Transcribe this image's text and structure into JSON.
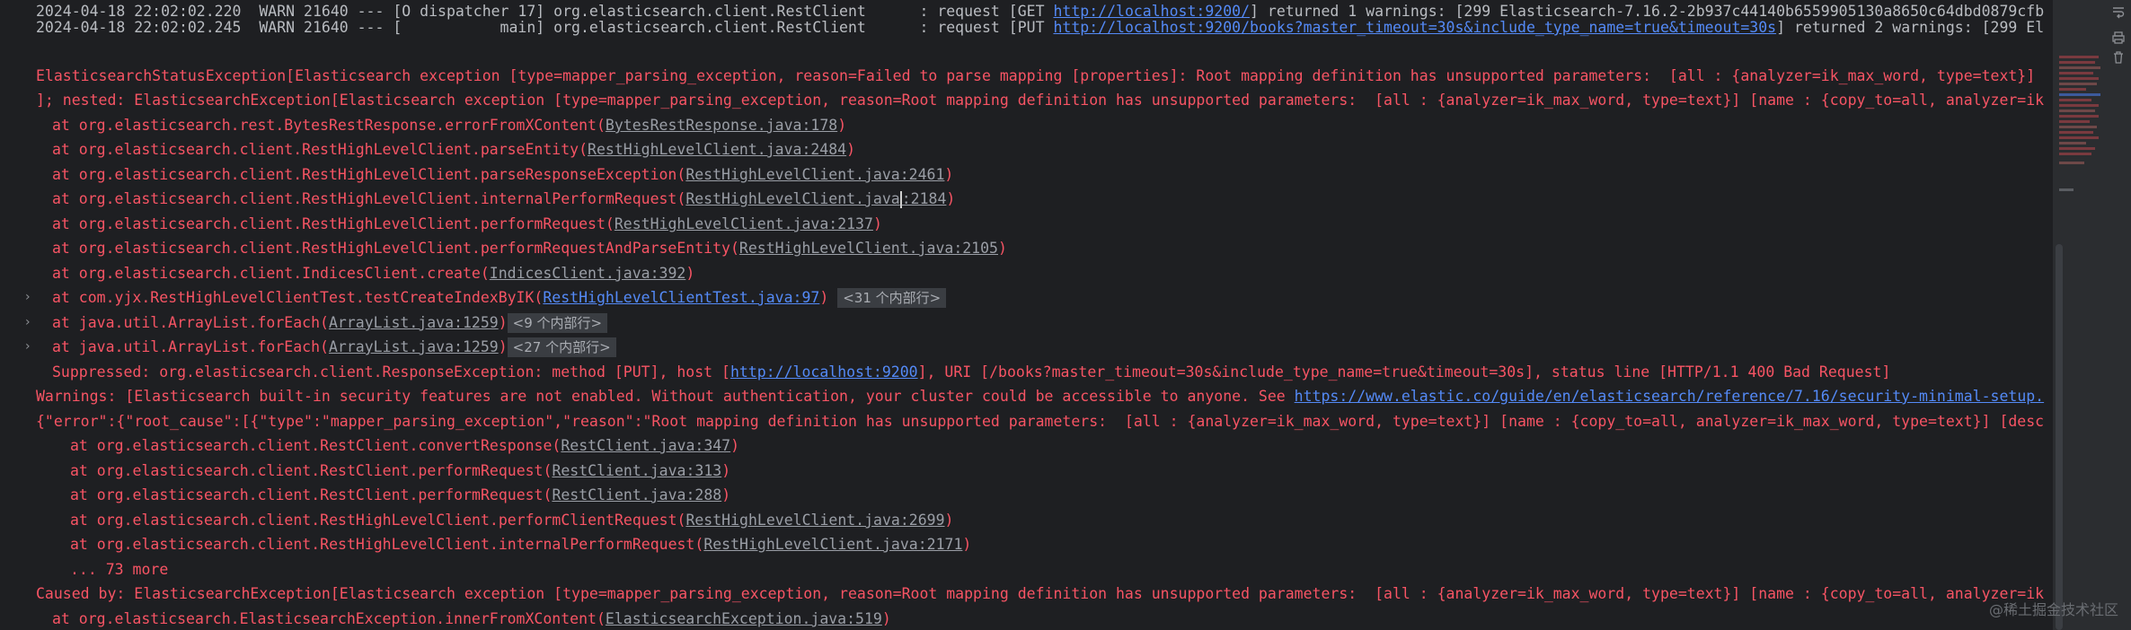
{
  "log": {
    "line1": {
      "prefix": "2024-04-18 22:02:02.220  WARN 21640 --- [O dispatcher 17] org.elasticsearch.client.RestClient      : request [GET ",
      "url": "http://localhost:9200/",
      "suffix": "] returned 1 warnings: [299 Elasticsearch-7.16.2-2b937c44140b6559905130a8650c64dbd0879cfb"
    },
    "line2": {
      "prefix": "2024-04-18 22:02:02.245  WARN 21640 --- [           main] org.elasticsearch.client.RestClient      : request [PUT ",
      "url": "http://localhost:9200/books?master_timeout=30s&include_type_name=true&timeout=30s",
      "suffix": "] returned 2 warnings: [299 El"
    }
  },
  "exception": {
    "header1": "ElasticsearchStatusException[Elasticsearch exception [type=mapper_parsing_exception, reason=Failed to parse mapping [properties]: Root mapping definition has unsupported parameters:  [all : {analyzer=ik_max_word, type=text}]",
    "header2": "]; nested: ElasticsearchException[Elasticsearch exception [type=mapper_parsing_exception, reason=Root mapping definition has unsupported parameters:  [all : {analyzer=ik_max_word, type=text}] [name : {copy_to=all, analyzer=ik"
  },
  "stack": [
    {
      "text": "at org.elasticsearch.rest.BytesRestResponse.errorFromXContent(",
      "link": "BytesRestResponse.java:178",
      "end": ")"
    },
    {
      "text": "at org.elasticsearch.client.RestHighLevelClient.parseEntity(",
      "link": "RestHighLevelClient.java:2484",
      "end": ")"
    },
    {
      "text": "at org.elasticsearch.client.RestHighLevelClient.parseResponseException(",
      "link": "RestHighLevelClient.java:2461",
      "end": ")"
    },
    {
      "text": "at org.elasticsearch.client.RestHighLevelClient.internalPerformRequest(",
      "link_a": "RestHighLevelClient.java",
      "link_b": ":2184",
      "end": ")"
    },
    {
      "text": "at org.elasticsearch.client.RestHighLevelClient.performRequest(",
      "link": "RestHighLevelClient.java:2137",
      "end": ")"
    },
    {
      "text": "at org.elasticsearch.client.RestHighLevelClient.performRequestAndParseEntity(",
      "link": "RestHighLevelClient.java:2105",
      "end": ")"
    },
    {
      "text": "at org.elasticsearch.client.IndicesClient.create(",
      "link": "IndicesClient.java:392",
      "end": ")"
    },
    {
      "text": "at com.yjx.RestHighLevelClientTest.testCreateIndexByIK(",
      "link": "RestHighLevelClientTest.java:97",
      "end": ")",
      "badge": "<31 个内部行>"
    },
    {
      "text": "at java.util.ArrayList.forEach(",
      "link": "ArrayList.java:1259",
      "end": ")",
      "badge": "<9 个内部行>"
    },
    {
      "text": "at java.util.ArrayList.forEach(",
      "link": "ArrayList.java:1259",
      "end": ")",
      "badge": "<27 个内部行>"
    }
  ],
  "suppressed": {
    "prefix": "Suppressed: org.elasticsearch.client.ResponseException: method [PUT], host [",
    "url": "http://localhost:9200",
    "suffix": "], URI [/books?master_timeout=30s&include_type_name=true&timeout=30s], status line [HTTP/1.1 400 Bad Request]"
  },
  "warnings": {
    "prefix": "Warnings: [Elasticsearch built-in security features are not enabled. Without authentication, your cluster could be accessible to anyone. See ",
    "url": "https://www.elastic.co/guide/en/elasticsearch/reference/7.16/security-minimal-setup."
  },
  "error_json": "{\"error\":{\"root_cause\":[{\"type\":\"mapper_parsing_exception\",\"reason\":\"Root mapping definition has unsupported parameters:  [all : {analyzer=ik_max_word, type=text}] [name : {copy_to=all, analyzer=ik_max_word, type=text}] [desc",
  "stack2": [
    {
      "text": "at org.elasticsearch.client.RestClient.convertResponse(",
      "link": "RestClient.java:347",
      "end": ")"
    },
    {
      "text": "at org.elasticsearch.client.RestClient.performRequest(",
      "link": "RestClient.java:313",
      "end": ")"
    },
    {
      "text": "at org.elasticsearch.client.RestClient.performRequest(",
      "link": "RestClient.java:288",
      "end": ")"
    },
    {
      "text": "at org.elasticsearch.client.RestHighLevelClient.performClientRequest(",
      "link": "RestHighLevelClient.java:2699",
      "end": ")"
    },
    {
      "text": "at org.elasticsearch.client.RestHighLevelClient.internalPerformRequest(",
      "link": "RestHighLevelClient.java:2171",
      "end": ")"
    }
  ],
  "more": "... 73 more",
  "caused_by": "Caused by: ElasticsearchException[Elasticsearch exception [type=mapper_parsing_exception, reason=Root mapping definition has unsupported parameters:  [all : {analyzer=ik_max_word, type=text}] [name : {copy_to=all, analyzer=ik",
  "last_frame": {
    "text": "at org.elasticsearch.ElasticsearchException.innerFromXContent(",
    "link": "ElasticsearchException.java:519",
    "end": ")"
  },
  "watermark": "@稀土掘金技术社区",
  "icons": {
    "expand": "chevron-right-icon",
    "wrap": "soft-wrap-icon",
    "print": "print-icon",
    "clear": "trash-icon"
  },
  "colors": {
    "background": "#1e1f22",
    "error_text": "#f75464",
    "log_text": "#b9bcc1",
    "link": "#548af7"
  }
}
